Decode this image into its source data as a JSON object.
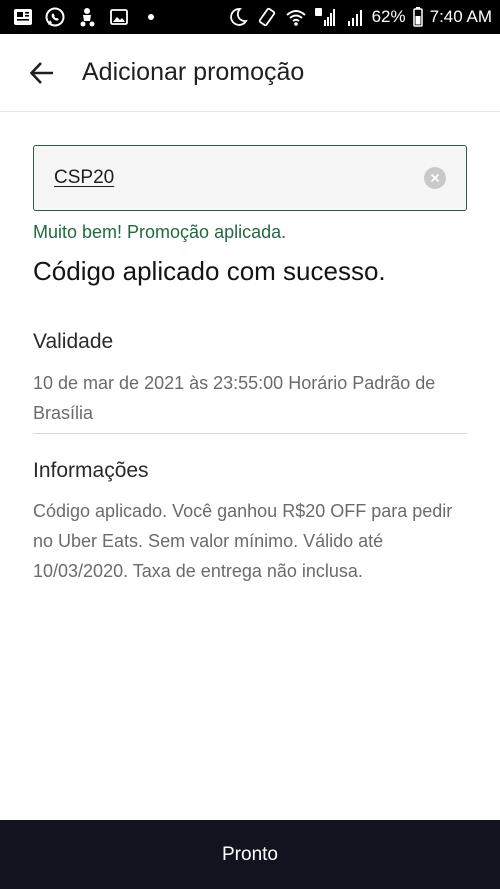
{
  "status_bar": {
    "battery": "62%",
    "time": "7:40 AM"
  },
  "header": {
    "title": "Adicionar promoção"
  },
  "promo": {
    "code_value": "CSP20",
    "success_message": "Muito bem! Promoção aplicada.",
    "applied_heading": "Código aplicado com sucesso."
  },
  "validity": {
    "label": "Validade",
    "value": "10 de mar de 2021 às 23:55:00 Horário Padrão de Brasília"
  },
  "info": {
    "label": "Informações",
    "value": "Código aplicado. Você ganhou R$20 OFF para pedir no Uber Eats. Sem valor mínimo. Válido até 10/03/2020. Taxa de entrega não inclusa."
  },
  "footer": {
    "button_label": "Pronto"
  },
  "colors": {
    "accent_green": "#1f6b40",
    "field_border": "#2c5d3e",
    "bottom_bar": "#13131f"
  }
}
